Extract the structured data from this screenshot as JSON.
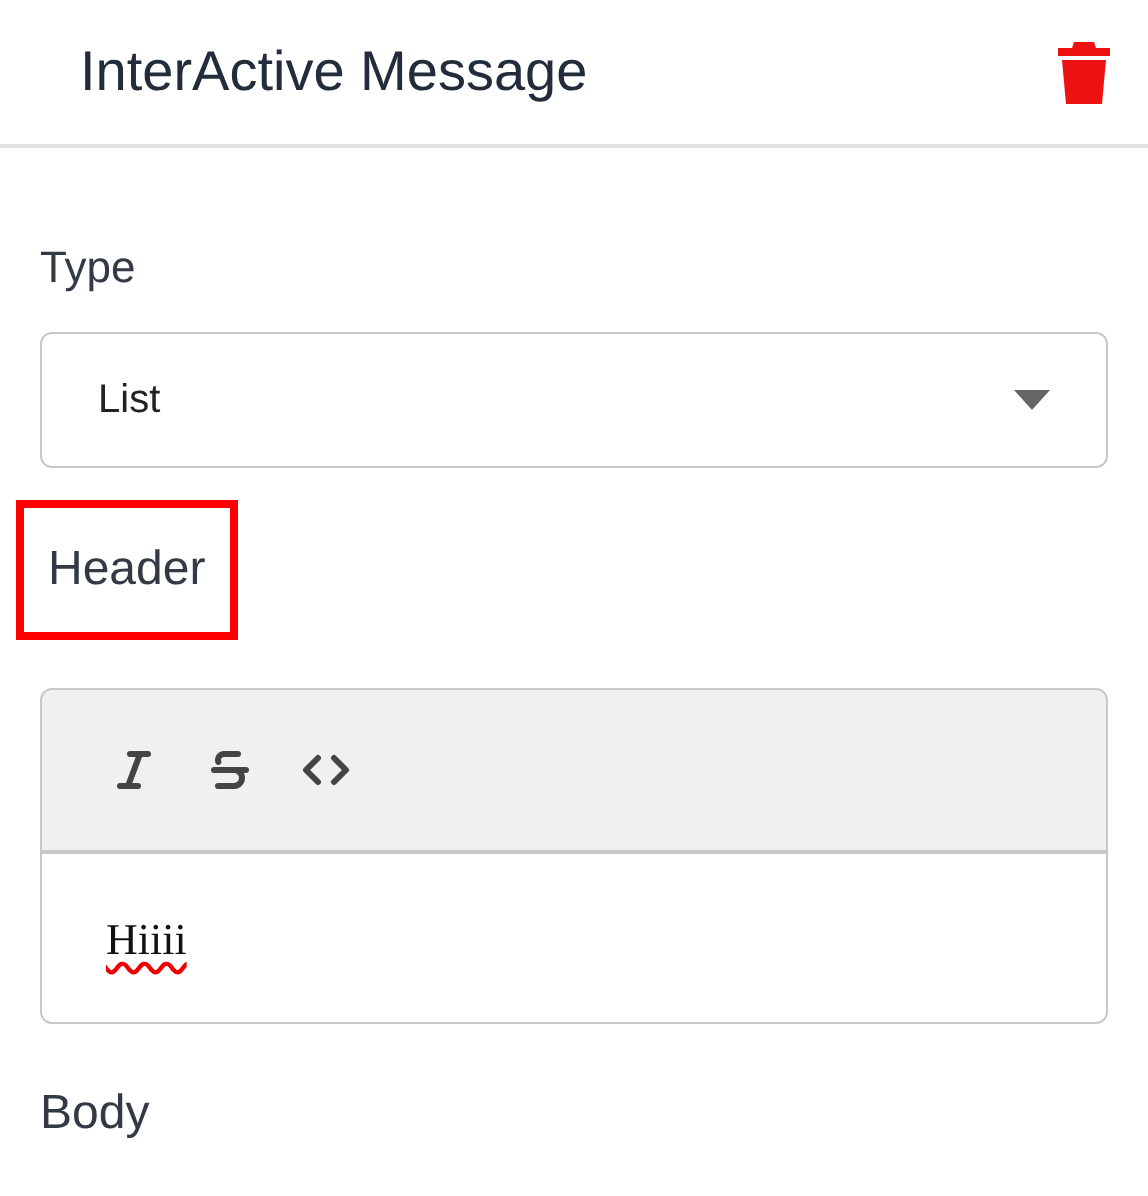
{
  "header": {
    "title": "InterActive Message"
  },
  "type_field": {
    "label": "Type",
    "value": "List"
  },
  "header_field": {
    "label": "Header",
    "highlighted": true,
    "toolbar": [
      {
        "kind": "italic"
      },
      {
        "kind": "strikethrough"
      },
      {
        "kind": "code"
      }
    ],
    "value": "Hiiii",
    "misspelled": true
  },
  "body_field": {
    "label": "Body"
  }
}
